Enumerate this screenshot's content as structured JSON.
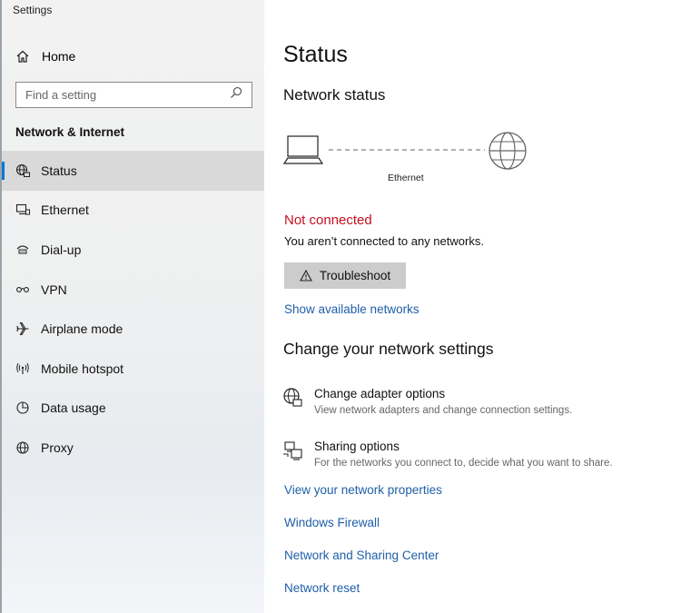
{
  "window": {
    "title": "Settings"
  },
  "sidebar": {
    "home_label": "Home",
    "search_placeholder": "Find a setting",
    "section_title": "Network & Internet",
    "items": [
      {
        "label": "Status",
        "icon": "globe-network-icon",
        "active": true
      },
      {
        "label": "Ethernet",
        "icon": "ethernet-icon"
      },
      {
        "label": "Dial-up",
        "icon": "dial-up-icon"
      },
      {
        "label": "VPN",
        "icon": "vpn-icon"
      },
      {
        "label": "Airplane mode",
        "icon": "airplane-icon"
      },
      {
        "label": "Mobile hotspot",
        "icon": "hotspot-icon"
      },
      {
        "label": "Data usage",
        "icon": "data-usage-icon"
      },
      {
        "label": "Proxy",
        "icon": "globe-icon"
      }
    ]
  },
  "main": {
    "title": "Status",
    "network_status_heading": "Network status",
    "connection_label": "Ethernet",
    "status_text": "Not connected",
    "status_message": "You aren’t connected to any networks.",
    "troubleshoot_label": "Troubleshoot",
    "show_networks_link": "Show available networks",
    "change_heading": "Change your network settings",
    "options": [
      {
        "title": "Change adapter options",
        "desc": "View network adapters and change connection settings.",
        "icon": "adapter-globe-icon"
      },
      {
        "title": "Sharing options",
        "desc": "For the networks you connect to, decide what you want to share.",
        "icon": "sharing-icon"
      }
    ],
    "links": [
      "View your network properties",
      "Windows Firewall",
      "Network and Sharing Center",
      "Network reset"
    ]
  },
  "colors": {
    "accent": "#0078d7",
    "link": "#1f5fa8",
    "error": "#c50f1f",
    "button_bg": "#cccccc",
    "active_item_bg": "#d9d9d9"
  }
}
